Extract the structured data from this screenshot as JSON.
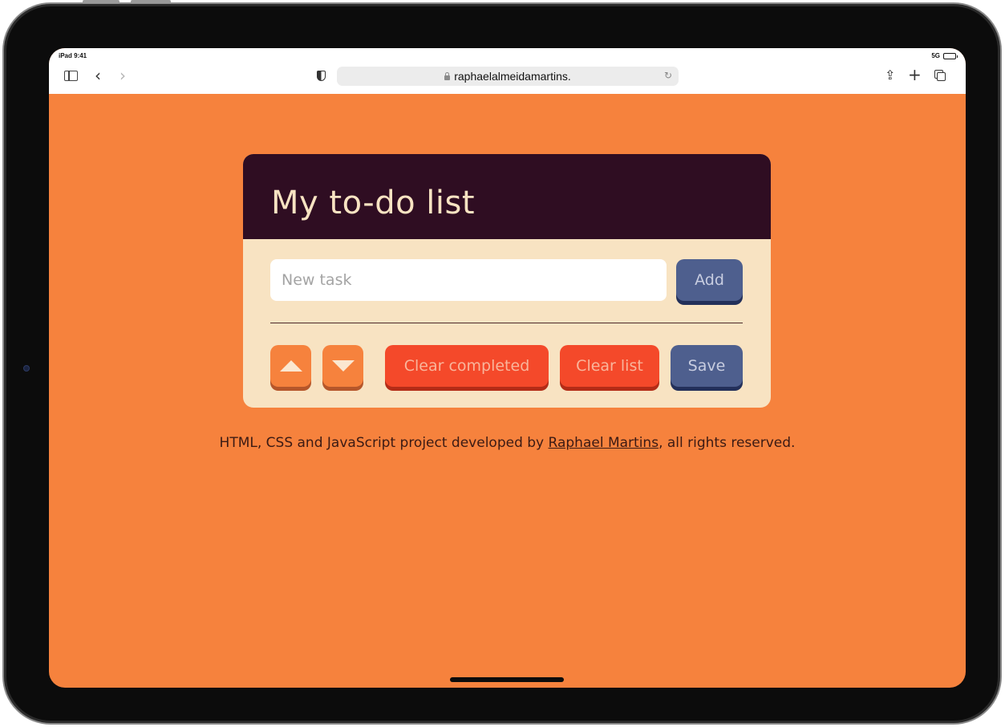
{
  "status_bar": {
    "left": "iPad 9:41",
    "right": "5G"
  },
  "browser": {
    "url": "raphaelalmeidamartins."
  },
  "todo": {
    "title": "My to-do list",
    "input_placeholder": "New task",
    "add_label": "Add",
    "clear_completed_label": "Clear completed",
    "clear_list_label": "Clear list",
    "save_label": "Save"
  },
  "footer": {
    "text_before": "HTML, CSS and JavaScript project developed by ",
    "link_text": "Raphael Martins",
    "text_after": ", all rights reserved."
  },
  "colors": {
    "page_background": "#f6823d",
    "card_header": "#2f0d22",
    "card_body": "#f8e3c2",
    "button_blue": "#4e5f8e",
    "button_red": "#f4492a"
  },
  "icons": [
    "sidebar-icon",
    "back-icon",
    "forward-icon",
    "shield-icon",
    "lock-icon",
    "reload-icon",
    "share-icon",
    "plus-icon",
    "tabs-icon",
    "arrow-up-icon",
    "arrow-down-icon"
  ]
}
